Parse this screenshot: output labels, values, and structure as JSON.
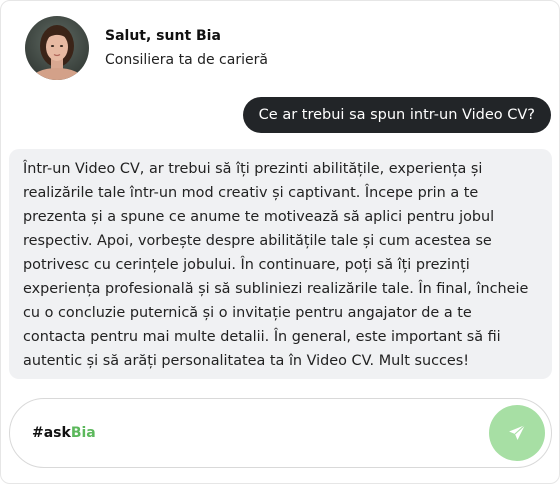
{
  "header": {
    "name": "Salut, sunt Bia",
    "role": "Consiliera ta de carieră",
    "avatar_icon": "woman-portrait-avatar"
  },
  "messages": {
    "user": "Ce ar trebui sa spun intr-un Video CV?",
    "assistant": "Într-un Video CV, ar trebui să îți prezinti abilitățile, experiența și realizările tale într-un mod creativ și captivant. Începe prin a te prezenta și a spune ce anume te motivează să aplici pentru jobul respectiv. Apoi, vorbește despre abilitățile tale și cum acestea se potrivesc cu cerințele jobului. În continuare, poți să îți prezinți experiența profesională și să subliniezi realizările tale. În final, încheie cu o concluzie puternică și o invitație pentru angajator de a te contacta pentru mai multe detalii. În general, este important să fii autentic și să arăți personalitatea ta în Video CV. Mult succes!"
  },
  "composer": {
    "hash": "#ask",
    "brand": "Bia",
    "send_icon": "send-paper-plane-icon"
  },
  "colors": {
    "accent_green": "#5cb85c",
    "send_button": "#a7dfa4",
    "user_bubble": "#222528",
    "bot_bubble": "#f0f1f3"
  }
}
